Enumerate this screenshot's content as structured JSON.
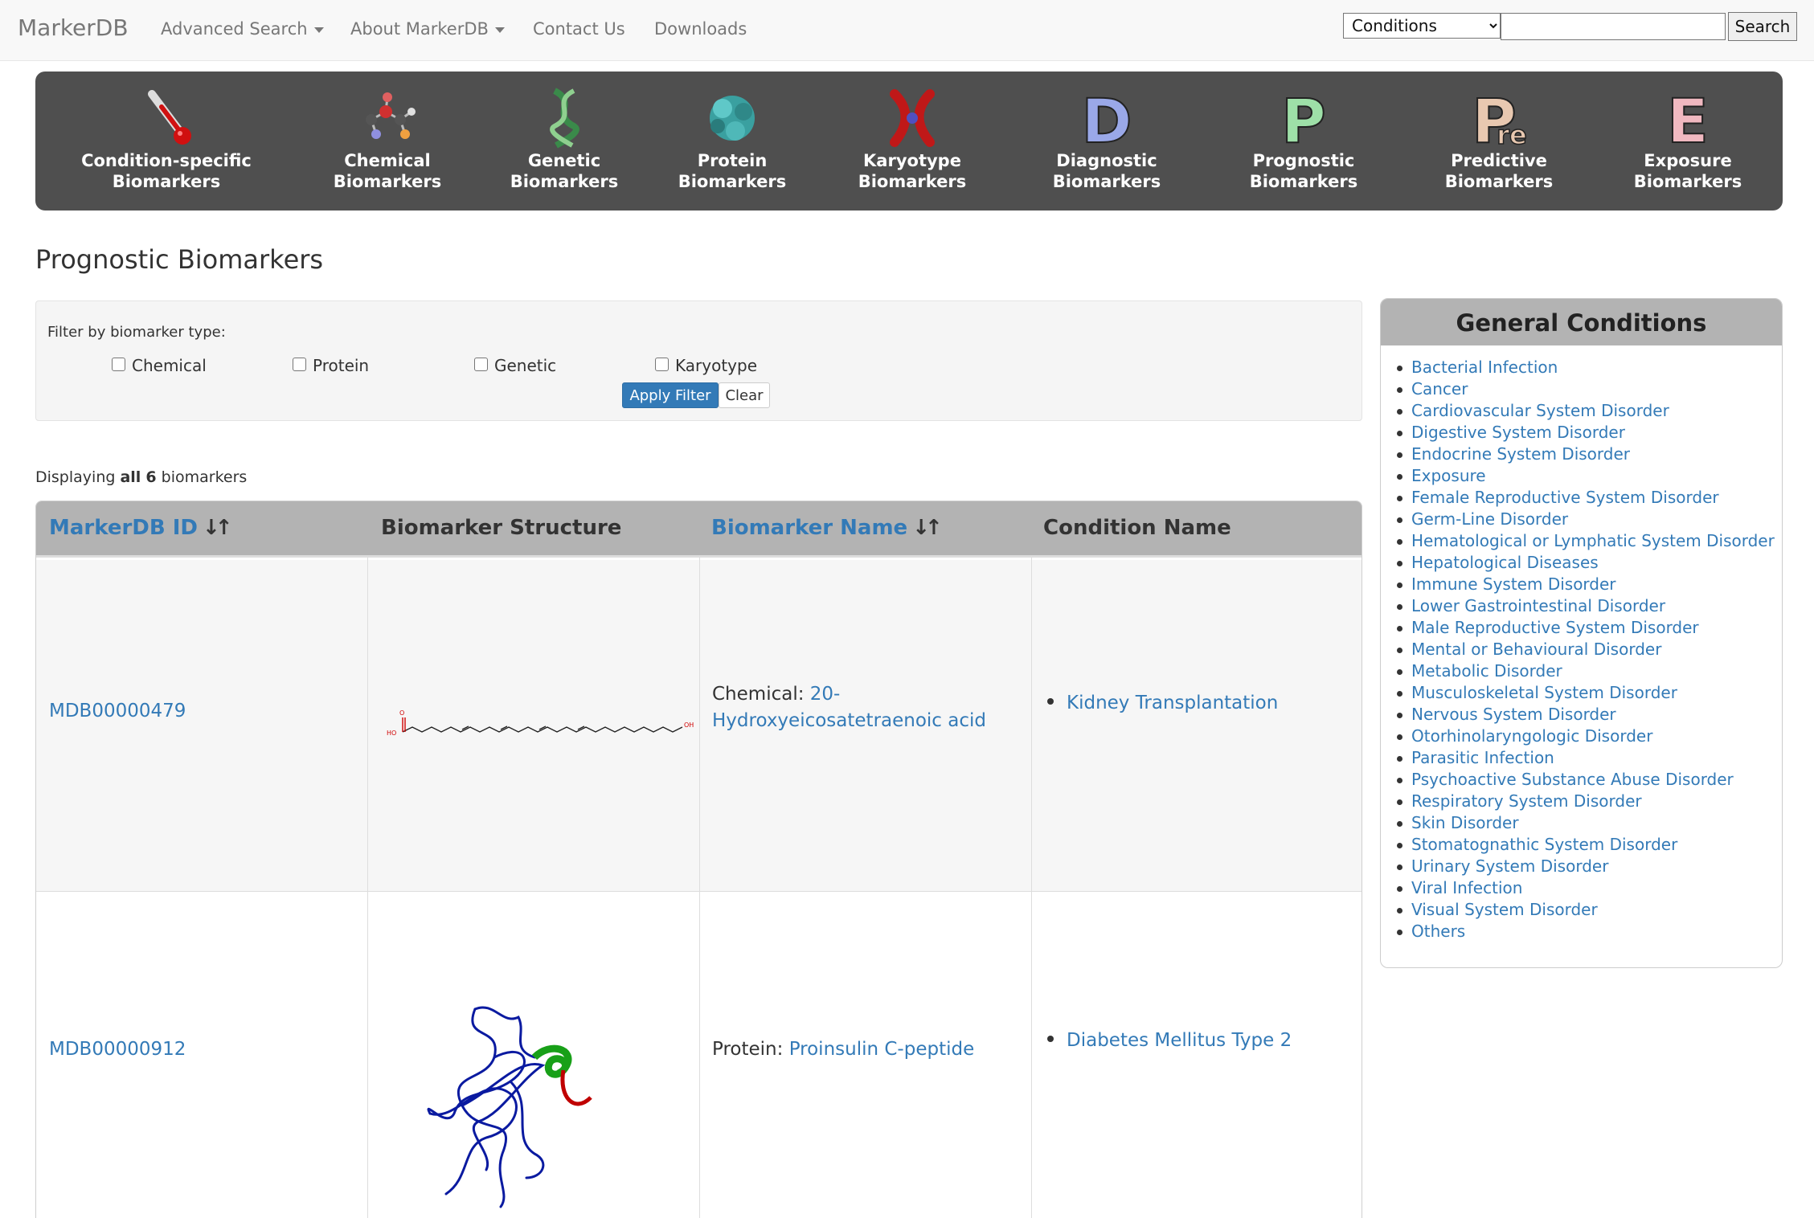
{
  "navbar": {
    "brand": "MarkerDB",
    "items": [
      {
        "label": "Advanced Search",
        "dropdown": true
      },
      {
        "label": "About MarkerDB",
        "dropdown": true
      },
      {
        "label": "Contact Us",
        "dropdown": false
      },
      {
        "label": "Downloads",
        "dropdown": false
      }
    ],
    "search_scope": "Conditions",
    "search_value": "",
    "search_button": "Search"
  },
  "categories": [
    {
      "line1": "Condition-specific",
      "line2": "Biomarkers",
      "icon": "thermometer-icon"
    },
    {
      "line1": "Chemical",
      "line2": "Biomarkers",
      "icon": "molecule-icon"
    },
    {
      "line1": "Genetic",
      "line2": "Biomarkers",
      "icon": "dna-icon"
    },
    {
      "line1": "Protein",
      "line2": "Biomarkers",
      "icon": "protein-icon"
    },
    {
      "line1": "Karyotype",
      "line2": "Biomarkers",
      "icon": "chromosome-icon"
    },
    {
      "line1": "Diagnostic",
      "line2": "Biomarkers",
      "icon": "letter-d-icon",
      "letter": "D"
    },
    {
      "line1": "Prognostic",
      "line2": "Biomarkers",
      "icon": "letter-p-icon",
      "letter": "P"
    },
    {
      "line1": "Predictive",
      "line2": "Biomarkers",
      "icon": "letter-pre-icon",
      "letter": "P",
      "sub": "re"
    },
    {
      "line1": "Exposure",
      "line2": "Biomarkers",
      "icon": "letter-e-icon",
      "letter": "E"
    }
  ],
  "page": {
    "title": "Prognostic Biomarkers"
  },
  "filter": {
    "label": "Filter by biomarker type:",
    "options": [
      "Chemical",
      "Protein",
      "Genetic",
      "Karyotype"
    ],
    "apply_label": "Apply Filter",
    "clear_label": "Clear"
  },
  "display": {
    "prefix": "Displaying",
    "all": "all",
    "count": "6",
    "suffix": "biomarkers"
  },
  "table": {
    "headers": {
      "id": "MarkerDB ID",
      "structure": "Biomarker Structure",
      "name": "Biomarker Name",
      "condition": "Condition Name"
    },
    "rows": [
      {
        "id": "MDB00000479",
        "structure_icon": "chemical-structure-icon",
        "type": "Chemical:",
        "name_line1": "20-",
        "name_line2": "Hydroxyeicosatetraenoic acid",
        "condition": "Kidney Transplantation"
      },
      {
        "id": "MDB00000912",
        "structure_icon": "protein-structure-icon",
        "type": "Protein:",
        "name_line1": "Proinsulin C-peptide",
        "name_line2": "",
        "condition": "Diabetes Mellitus Type 2"
      }
    ]
  },
  "general_conditions": {
    "title": "General Conditions",
    "items": [
      "Bacterial Infection",
      "Cancer",
      "Cardiovascular System Disorder",
      "Digestive System Disorder",
      "Endocrine System Disorder",
      "Exposure",
      "Female Reproductive System Disorder",
      "Germ-Line Disorder",
      "Hematological or Lymphatic System Disorder",
      "Hepatological Diseases",
      "Immune System Disorder",
      "Lower Gastrointestinal Disorder",
      "Male Reproductive System Disorder",
      "Mental or Behavioural Disorder",
      "Metabolic Disorder",
      "Musculoskeletal System Disorder",
      "Nervous System Disorder",
      "Otorhinolaryngologic Disorder",
      "Parasitic Infection",
      "Psychoactive Substance Abuse Disorder",
      "Respiratory System Disorder",
      "Skin Disorder",
      "Stomatognathic System Disorder",
      "Urinary System Disorder",
      "Viral Infection",
      "Visual System Disorder",
      "Others"
    ]
  },
  "colors": {
    "link": "#337ab7",
    "banner": "#4f4f4f",
    "header_gray": "#b3b3b3",
    "primary_button": "#337ab7"
  }
}
